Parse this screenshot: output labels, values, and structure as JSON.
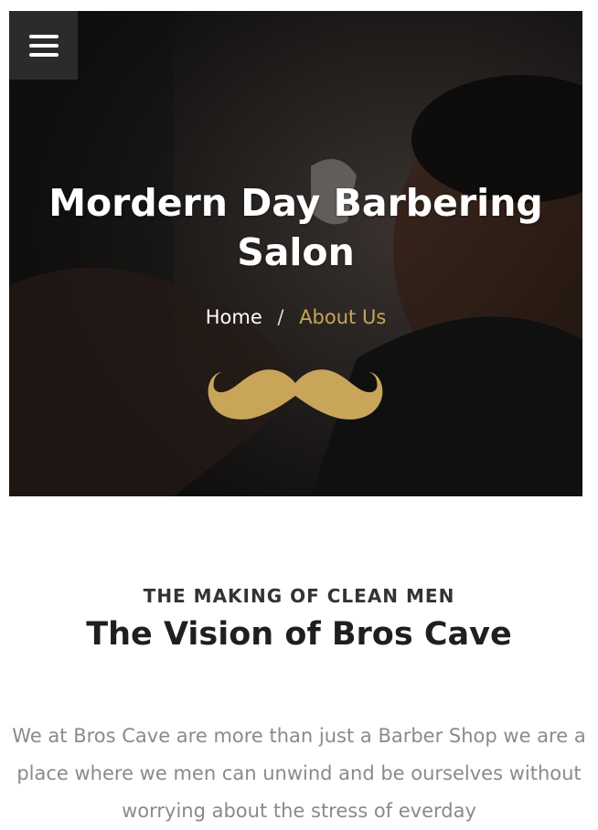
{
  "hero": {
    "title": "Mordern Day Barbering Salon",
    "breadcrumb": {
      "home": "Home",
      "separator": "/",
      "current": "About Us"
    },
    "accent_color": "#c9a55a"
  },
  "menu": {
    "icon": "hamburger-menu-icon"
  },
  "about": {
    "kicker": "THE MAKING OF CLEAN MEN",
    "heading": "The Vision of Bros Cave",
    "body": "We at Bros Cave are more than just a Barber Shop we are a place where we men can unwind and be ourselves without worrying about the stress of everday"
  }
}
